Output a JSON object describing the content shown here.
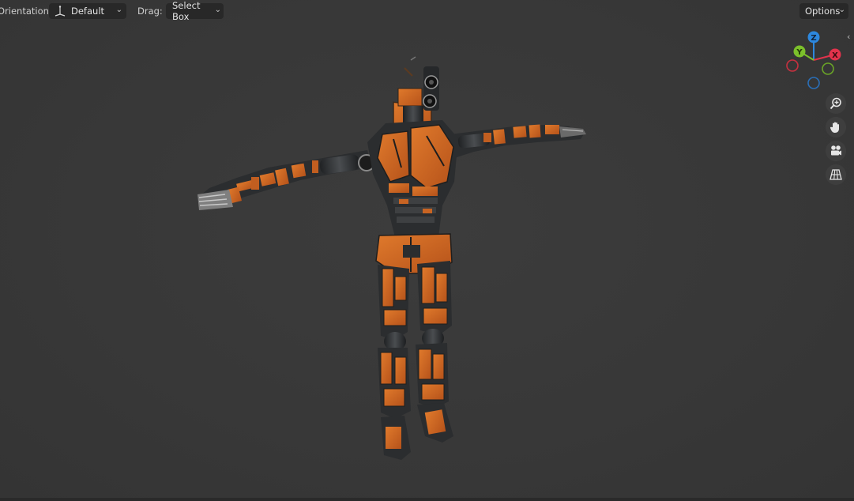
{
  "header": {
    "orientation_label": "Orientation:",
    "orientation_value": "Default",
    "drag_label": "Drag:",
    "drag_value": "Select Box",
    "options_label": "Options"
  },
  "gizmo": {
    "x_label": "X",
    "y_label": "Y",
    "z_label": "Z",
    "x_color": "#e2334c",
    "y_color": "#7cc02b",
    "z_color": "#2d88df"
  },
  "nav_buttons": [
    "zoom-icon",
    "hand-pan-icon",
    "camera-icon",
    "perspective-grid-icon"
  ],
  "model": {
    "primary_color": "#d2661e",
    "secondary_color": "#2a2c2e"
  }
}
